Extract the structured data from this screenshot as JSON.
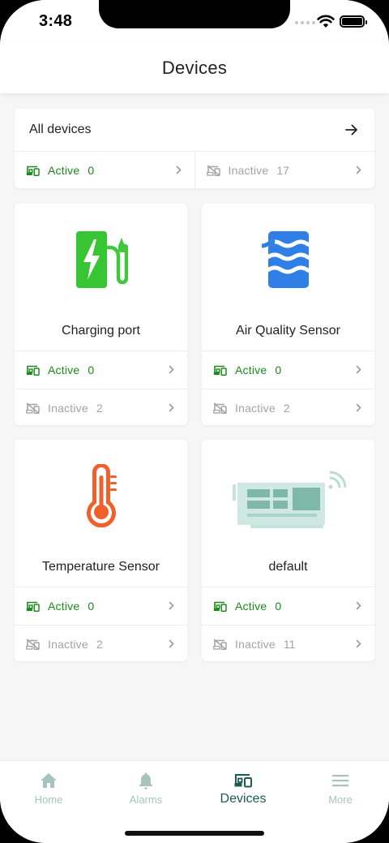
{
  "status": {
    "time": "3:48"
  },
  "header": {
    "title": "Devices"
  },
  "all_devices": {
    "title": "All devices",
    "active_label": "Active",
    "active_count": "0",
    "inactive_label": "Inactive",
    "inactive_count": "17"
  },
  "device_types": [
    {
      "name": "Charging port",
      "icon": "ev-charger-icon",
      "active_label": "Active",
      "active_count": "0",
      "inactive_label": "Inactive",
      "inactive_count": "2"
    },
    {
      "name": "Air Quality Sensor",
      "icon": "air-wave-icon",
      "active_label": "Active",
      "active_count": "0",
      "inactive_label": "Inactive",
      "inactive_count": "2"
    },
    {
      "name": "Temperature Sensor",
      "icon": "thermometer-icon",
      "active_label": "Active",
      "active_count": "0",
      "inactive_label": "Inactive",
      "inactive_count": "2"
    },
    {
      "name": "default",
      "icon": "circuit-board-icon",
      "active_label": "Active",
      "active_count": "0",
      "inactive_label": "Inactive",
      "inactive_count": "11"
    }
  ],
  "tabbar": {
    "tabs": [
      {
        "label": "Home",
        "icon": "home-icon"
      },
      {
        "label": "Alarms",
        "icon": "bell-icon"
      },
      {
        "label": "Devices",
        "icon": "devices-icon",
        "selected": true
      },
      {
        "label": "More",
        "icon": "menu-icon"
      }
    ]
  },
  "colors": {
    "active": "#1b8a1b",
    "inactive": "#a3a3a3",
    "accent": "#1d5a50",
    "tab_inactive": "#a6c4bd"
  }
}
